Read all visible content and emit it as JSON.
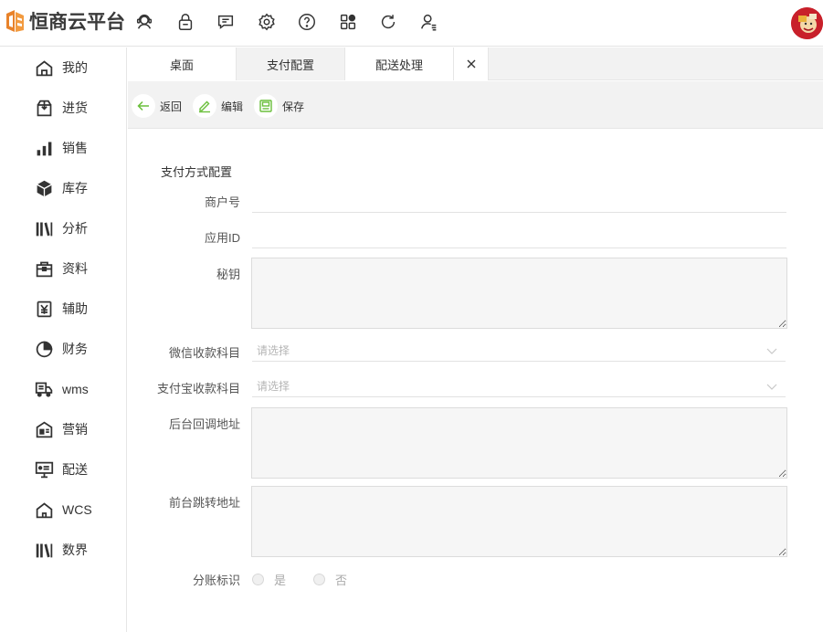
{
  "app": {
    "logo_text": "恒商云平台"
  },
  "header": {
    "icons": [
      "user-headset-icon",
      "lock-icon",
      "message-icon",
      "gear-icon",
      "help-icon",
      "apps-grid-icon",
      "refresh-icon",
      "user-settings-icon"
    ]
  },
  "sidebar": {
    "items": [
      {
        "label": "我的",
        "icon": "home-icon"
      },
      {
        "label": "进货",
        "icon": "package-in-icon"
      },
      {
        "label": "销售",
        "icon": "bar-chart-icon"
      },
      {
        "label": "库存",
        "icon": "box-icon"
      },
      {
        "label": "分析",
        "icon": "books-icon"
      },
      {
        "label": "资料",
        "icon": "briefcase-icon"
      },
      {
        "label": "辅助",
        "icon": "yen-doc-icon"
      },
      {
        "label": "财务",
        "icon": "pie-chart-icon"
      },
      {
        "label": "wms",
        "icon": "truck-icon"
      },
      {
        "label": "营销",
        "icon": "store-icon"
      },
      {
        "label": "配送",
        "icon": "monitor-icon"
      },
      {
        "label": "WCS",
        "icon": "house-icon"
      },
      {
        "label": "数界",
        "icon": "books-icon"
      }
    ]
  },
  "tabs": [
    {
      "label": "桌面"
    },
    {
      "label": "支付配置"
    },
    {
      "label": "配送处理"
    }
  ],
  "toolbar": {
    "back_label": "返回",
    "edit_label": "编辑",
    "save_label": "保存"
  },
  "form": {
    "section_title": "支付方式配置",
    "merchant_no_label": "商户号",
    "app_id_label": "应用ID",
    "secret_label": "秘钥",
    "wechat_account_label": "微信收款科目",
    "alipay_account_label": "支付宝收款科目",
    "select_placeholder": "请选择",
    "callback_url_label": "后台回调地址",
    "redirect_url_label": "前台跳转地址",
    "split_flag_label": "分账标识",
    "split_yes": "是",
    "split_no": "否"
  }
}
